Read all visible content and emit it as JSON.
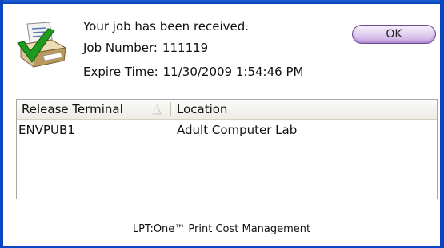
{
  "message": {
    "received": "Your job has been received.",
    "job_number_label": "Job Number:",
    "job_number": "111119",
    "expire_label": "Expire Time:",
    "expire_time": "11/30/2009 1:54:46 PM"
  },
  "ok_button": {
    "label": "OK"
  },
  "table": {
    "columns": [
      "Release Terminal",
      "Location"
    ],
    "sort_column": "Release Terminal",
    "rows": [
      {
        "terminal": "ENVPUB1",
        "location": "Adult Computer Lab"
      }
    ]
  },
  "footer": {
    "text": "LPT:One™ Print Cost Management"
  },
  "colors": {
    "frame": "#0b46c2",
    "ok_button": "#d9c2ec",
    "check": "#1f9a1f"
  },
  "icons": {
    "printer": "printer-with-checkmark-icon",
    "sort": "sort-ascending-icon"
  }
}
